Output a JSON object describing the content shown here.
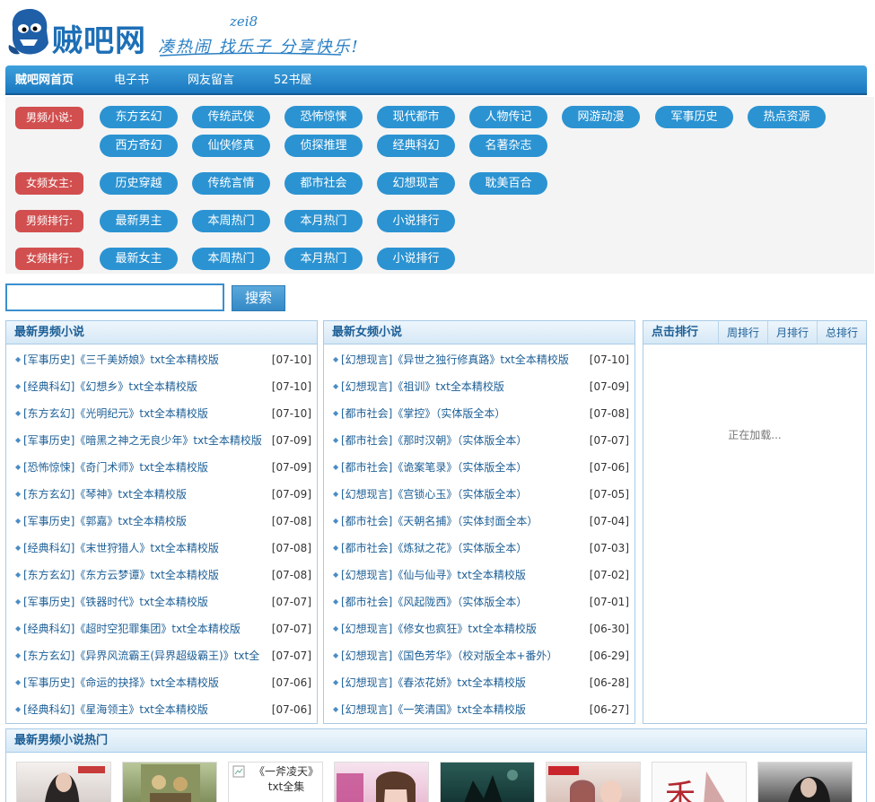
{
  "header": {
    "logo_text": "贼吧网",
    "logo_small": "zei8",
    "slogan": "凑热闹 找乐子 分享快乐!"
  },
  "nav": {
    "items": [
      "贼吧网首页",
      "电子书",
      "网友留言",
      "52书屋"
    ]
  },
  "categories": [
    {
      "label": "男频小说:",
      "items": [
        "东方玄幻",
        "传统武侠",
        "恐怖惊悚",
        "现代都市",
        "人物传记",
        "网游动漫",
        "军事历史",
        "热点资源",
        "西方奇幻",
        "仙侠修真",
        "侦探推理",
        "经典科幻",
        "名著杂志"
      ]
    },
    {
      "label": "女频女主:",
      "items": [
        "历史穿越",
        "传统言情",
        "都市社会",
        "幻想现言",
        "耽美百合"
      ]
    },
    {
      "label": "男频排行:",
      "items": [
        "最新男主",
        "本周热门",
        "本月热门",
        "小说排行"
      ]
    },
    {
      "label": "女频排行:",
      "items": [
        "最新女主",
        "本周热门",
        "本月热门",
        "小说排行"
      ]
    }
  ],
  "search": {
    "value": "",
    "button": "搜索"
  },
  "male_list": {
    "title": "最新男频小说",
    "rows": [
      {
        "t": "[军事历史]《三千美娇娘》txt全本精校版",
        "d": "[07-10]"
      },
      {
        "t": "[经典科幻]《幻想乡》txt全本精校版",
        "d": "[07-10]"
      },
      {
        "t": "[东方玄幻]《光明纪元》txt全本精校版",
        "d": "[07-10]"
      },
      {
        "t": "[军事历史]《暗黑之神之无良少年》txt全本精校版",
        "d": "[07-09]"
      },
      {
        "t": "[恐怖惊悚]《奇门术师》txt全本精校版",
        "d": "[07-09]"
      },
      {
        "t": "[东方玄幻]《琴神》txt全本精校版",
        "d": "[07-09]"
      },
      {
        "t": "[军事历史]《郭嘉》txt全本精校版",
        "d": "[07-08]"
      },
      {
        "t": "[经典科幻]《末世狩猎人》txt全本精校版",
        "d": "[07-08]"
      },
      {
        "t": "[东方玄幻]《东方云梦谭》txt全本精校版",
        "d": "[07-08]"
      },
      {
        "t": "[军事历史]《铁器时代》txt全本精校版",
        "d": "[07-07]"
      },
      {
        "t": "[经典科幻]《超时空犯罪集团》txt全本精校版",
        "d": "[07-07]"
      },
      {
        "t": "[东方玄幻]《异界风流霸王(异界超级霸王)》txt全",
        "d": "[07-07]"
      },
      {
        "t": "[军事历史]《命运的抉择》txt全本精校版",
        "d": "[07-06]"
      },
      {
        "t": "[经典科幻]《星海领主》txt全本精校版",
        "d": "[07-06]"
      }
    ]
  },
  "female_list": {
    "title": "最新女频小说",
    "rows": [
      {
        "t": "[幻想现言]《异世之独行修真路》txt全本精校版",
        "d": "[07-10]"
      },
      {
        "t": "[幻想现言]《祖训》txt全本精校版",
        "d": "[07-09]"
      },
      {
        "t": "[都市社会]《掌控》（实体版全本）",
        "d": "[07-08]"
      },
      {
        "t": "[都市社会]《那时汉朝》（实体版全本）",
        "d": "[07-07]"
      },
      {
        "t": "[都市社会]《诡案笔录》（实体版全本）",
        "d": "[07-06]"
      },
      {
        "t": "[幻想现言]《宫锁心玉》（实体版全本）",
        "d": "[07-05]"
      },
      {
        "t": "[都市社会]《天朝名捕》（实体封面全本）",
        "d": "[07-04]"
      },
      {
        "t": "[都市社会]《炼狱之花》（实体版全本）",
        "d": "[07-03]"
      },
      {
        "t": "[幻想现言]《仙与仙寻》txt全本精校版",
        "d": "[07-02]"
      },
      {
        "t": "[都市社会]《风起陇西》（实体版全本）",
        "d": "[07-01]"
      },
      {
        "t": "[幻想现言]《修女也疯狂》txt全本精校版",
        "d": "[06-30]"
      },
      {
        "t": "[幻想现言]《国色芳华》（校对版全本+番外）",
        "d": "[06-29]"
      },
      {
        "t": "[幻想现言]《春浓花娇》txt全本精校版",
        "d": "[06-28]"
      },
      {
        "t": "[幻想现言]《一笑清国》txt全本精校版",
        "d": "[06-27]"
      }
    ]
  },
  "rank": {
    "title": "点击排行",
    "tabs": [
      "周排行",
      "月排行",
      "总排行"
    ],
    "loading": "正在加载..."
  },
  "hot": {
    "title": "最新男频小说热门",
    "broken_alt": "《一斧凌天》txt全集"
  }
}
